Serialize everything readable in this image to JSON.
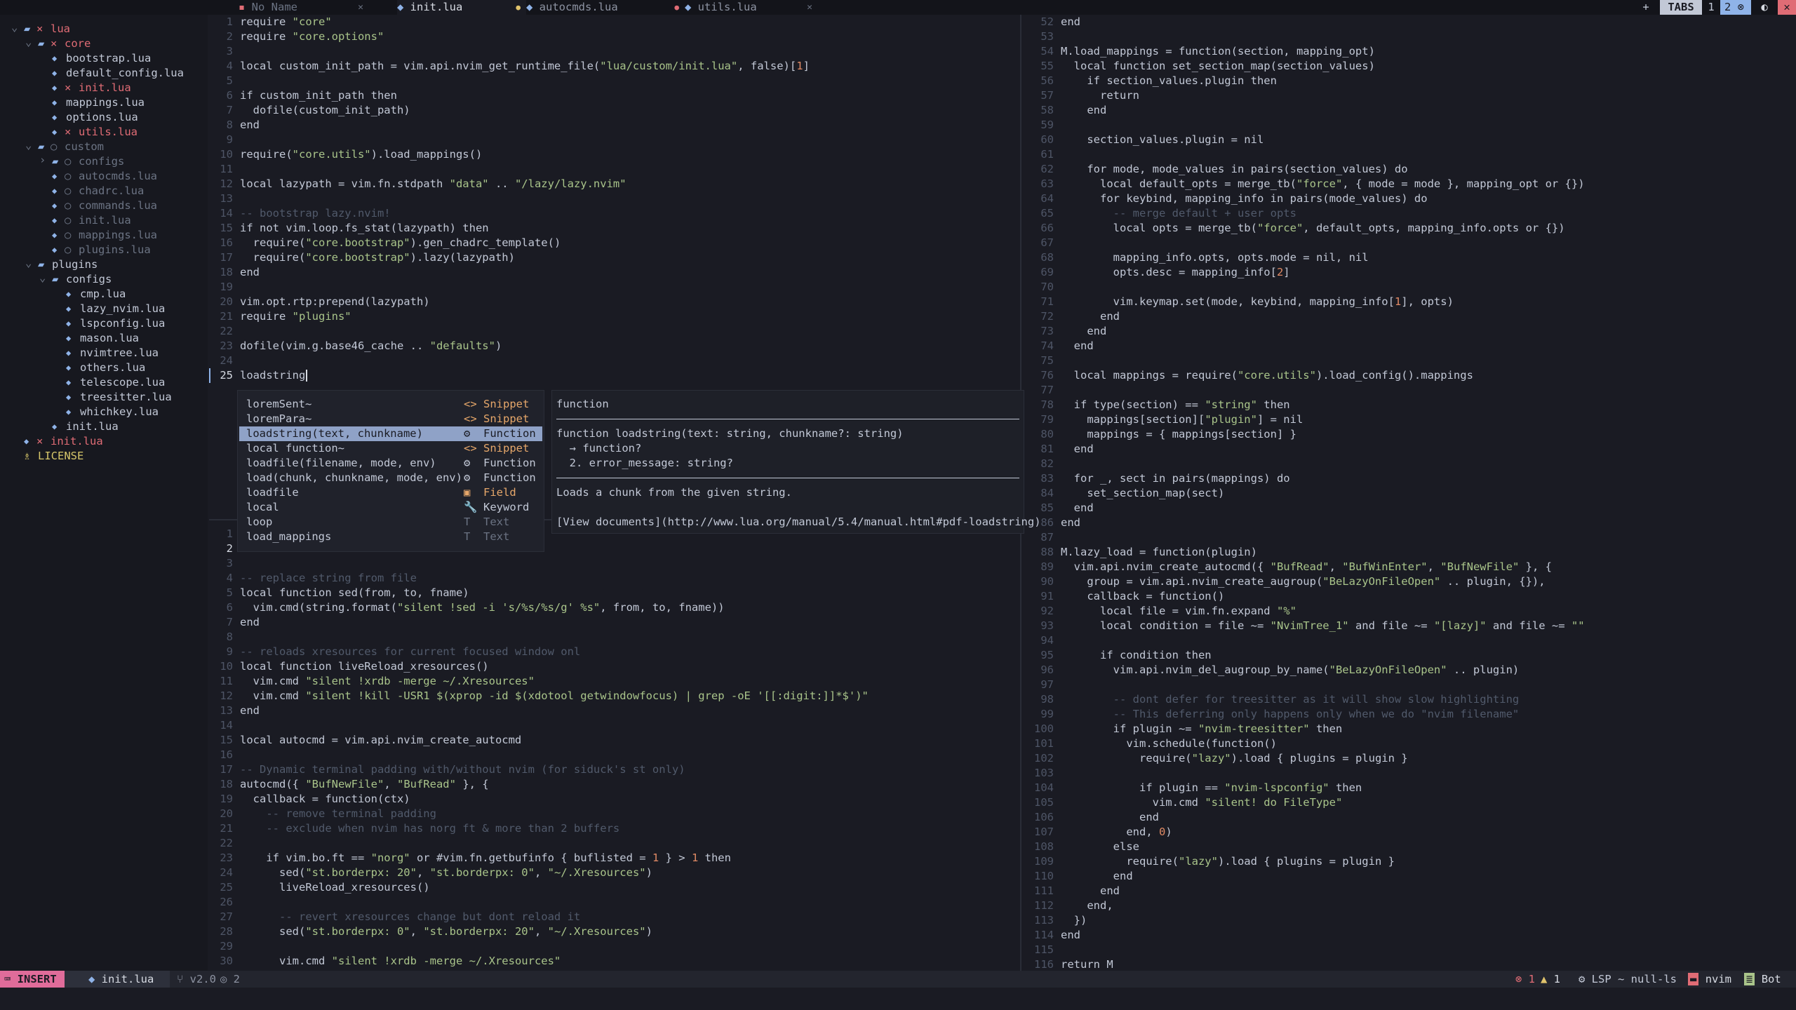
{
  "tabs": [
    {
      "label": "No Name",
      "icon": "file-icon",
      "mark": "close",
      "color": "#6b7383"
    },
    {
      "label": "init.lua",
      "icon": "lua-icon",
      "mark": "modified",
      "color": "#d7dbe3"
    },
    {
      "label": "autocmds.lua",
      "icon": "lua-icon",
      "mark": "error",
      "color": "#8d93a2"
    },
    {
      "label": "utils.lua",
      "icon": "lua-icon",
      "mark": "close",
      "color": "#8d93a2"
    }
  ],
  "tabbar_right": {
    "plus": "+",
    "tabs_label": "TABS",
    "tab1": "1",
    "tab2": "2"
  },
  "tree": [
    {
      "indent": 0,
      "arrow": "v",
      "icon": "folder-open-icon",
      "mark": "×",
      "label": "lua",
      "color": "#e06c75"
    },
    {
      "indent": 1,
      "arrow": "v",
      "icon": "folder-open-icon",
      "mark": "×",
      "label": "core",
      "color": "#e06c75"
    },
    {
      "indent": 2,
      "arrow": "",
      "icon": "lua-icon",
      "mark": "",
      "label": "bootstrap.lua",
      "color": "#c2c8d6"
    },
    {
      "indent": 2,
      "arrow": "",
      "icon": "lua-icon",
      "mark": "",
      "label": "default_config.lua",
      "color": "#c2c8d6"
    },
    {
      "indent": 2,
      "arrow": "",
      "icon": "lua-icon",
      "mark": "×",
      "label": "init.lua",
      "color": "#e06c75"
    },
    {
      "indent": 2,
      "arrow": "",
      "icon": "lua-icon",
      "mark": "",
      "label": "mappings.lua",
      "color": "#c2c8d6"
    },
    {
      "indent": 2,
      "arrow": "",
      "icon": "lua-icon",
      "mark": "",
      "label": "options.lua",
      "color": "#c2c8d6"
    },
    {
      "indent": 2,
      "arrow": "",
      "icon": "lua-icon",
      "mark": "×",
      "label": "utils.lua",
      "color": "#e06c75"
    },
    {
      "indent": 1,
      "arrow": "v",
      "icon": "folder-open-icon",
      "mark": "○",
      "label": "custom",
      "color": "#6b7383"
    },
    {
      "indent": 2,
      "arrow": ">",
      "icon": "folder-icon",
      "mark": "○",
      "label": "configs",
      "color": "#6b7383"
    },
    {
      "indent": 2,
      "arrow": "",
      "icon": "lua-icon",
      "mark": "○",
      "label": "autocmds.lua",
      "color": "#6b7383"
    },
    {
      "indent": 2,
      "arrow": "",
      "icon": "lua-icon",
      "mark": "○",
      "label": "chadrc.lua",
      "color": "#6b7383"
    },
    {
      "indent": 2,
      "arrow": "",
      "icon": "lua-icon",
      "mark": "○",
      "label": "commands.lua",
      "color": "#6b7383"
    },
    {
      "indent": 2,
      "arrow": "",
      "icon": "lua-icon",
      "mark": "○",
      "label": "init.lua",
      "color": "#6b7383"
    },
    {
      "indent": 2,
      "arrow": "",
      "icon": "lua-icon",
      "mark": "○",
      "label": "mappings.lua",
      "color": "#6b7383"
    },
    {
      "indent": 2,
      "arrow": "",
      "icon": "lua-icon",
      "mark": "○",
      "label": "plugins.lua",
      "color": "#6b7383"
    },
    {
      "indent": 1,
      "arrow": "v",
      "icon": "folder-open-icon",
      "mark": "",
      "label": "plugins",
      "color": "#c2c8d6"
    },
    {
      "indent": 2,
      "arrow": "v",
      "icon": "folder-open-icon",
      "mark": "",
      "label": "configs",
      "color": "#c2c8d6"
    },
    {
      "indent": 3,
      "arrow": "",
      "icon": "lua-icon",
      "mark": "",
      "label": "cmp.lua",
      "color": "#c2c8d6"
    },
    {
      "indent": 3,
      "arrow": "",
      "icon": "lua-icon",
      "mark": "",
      "label": "lazy_nvim.lua",
      "color": "#c2c8d6"
    },
    {
      "indent": 3,
      "arrow": "",
      "icon": "lua-icon",
      "mark": "",
      "label": "lspconfig.lua",
      "color": "#c2c8d6"
    },
    {
      "indent": 3,
      "arrow": "",
      "icon": "lua-icon",
      "mark": "",
      "label": "mason.lua",
      "color": "#c2c8d6"
    },
    {
      "indent": 3,
      "arrow": "",
      "icon": "lua-icon",
      "mark": "",
      "label": "nvimtree.lua",
      "color": "#c2c8d6"
    },
    {
      "indent": 3,
      "arrow": "",
      "icon": "lua-icon",
      "mark": "",
      "label": "others.lua",
      "color": "#c2c8d6"
    },
    {
      "indent": 3,
      "arrow": "",
      "icon": "lua-icon",
      "mark": "",
      "label": "telescope.lua",
      "color": "#c2c8d6"
    },
    {
      "indent": 3,
      "arrow": "",
      "icon": "lua-icon",
      "mark": "",
      "label": "treesitter.lua",
      "color": "#c2c8d6"
    },
    {
      "indent": 3,
      "arrow": "",
      "icon": "lua-icon",
      "mark": "",
      "label": "whichkey.lua",
      "color": "#c2c8d6"
    },
    {
      "indent": 2,
      "arrow": "",
      "icon": "lua-icon",
      "mark": "",
      "label": "init.lua",
      "color": "#c2c8d6"
    },
    {
      "indent": 0,
      "arrow": "",
      "icon": "lua-icon",
      "mark": "×",
      "label": "init.lua",
      "color": "#e06c75"
    },
    {
      "indent": 0,
      "arrow": "",
      "icon": "license-icon",
      "mark": "",
      "label": "LICENSE",
      "color": "#d7c76a"
    }
  ],
  "pane_top": [
    [
      "1",
      "require \"core\""
    ],
    [
      "2",
      "require \"core.options\""
    ],
    [
      "3",
      ""
    ],
    [
      "4",
      "local custom_init_path = vim.api.nvim_get_runtime_file(\"lua/custom/init.lua\", false)[1]"
    ],
    [
      "5",
      ""
    ],
    [
      "6",
      "if custom_init_path then"
    ],
    [
      "7",
      "  dofile(custom_init_path)"
    ],
    [
      "8",
      "end"
    ],
    [
      "9",
      ""
    ],
    [
      "10",
      "require(\"core.utils\").load_mappings()"
    ],
    [
      "11",
      ""
    ],
    [
      "12",
      "local lazypath = vim.fn.stdpath \"data\" .. \"/lazy/lazy.nvim\""
    ],
    [
      "13",
      ""
    ],
    [
      "14",
      "-- bootstrap lazy.nvim!"
    ],
    [
      "15",
      "if not vim.loop.fs_stat(lazypath) then"
    ],
    [
      "16",
      "  require(\"core.bootstrap\").gen_chadrc_template()"
    ],
    [
      "17",
      "  require(\"core.bootstrap\").lazy(lazypath)"
    ],
    [
      "18",
      "end"
    ],
    [
      "19",
      ""
    ],
    [
      "20",
      "vim.opt.rtp:prepend(lazypath)"
    ],
    [
      "21",
      "require \"plugins\""
    ],
    [
      "22",
      ""
    ],
    [
      "23",
      "dofile(vim.g.base46_cache .. \"defaults\")"
    ],
    [
      "24",
      ""
    ],
    [
      "25",
      "loadstring"
    ]
  ],
  "pane_bottom": [
    [
      "1",
      ""
    ],
    [
      "2",
      ""
    ],
    [
      "3",
      ""
    ],
    [
      "4",
      "-- replace string from file"
    ],
    [
      "5",
      "local function sed(from, to, fname)"
    ],
    [
      "6",
      "  vim.cmd(string.format(\"silent !sed -i 's/%s/%s/g' %s\", from, to, fname))"
    ],
    [
      "7",
      "end"
    ],
    [
      "8",
      ""
    ],
    [
      "9",
      "-- reloads xresources for current focused window onl"
    ],
    [
      "10",
      "local function liveReload_xresources()"
    ],
    [
      "11",
      "  vim.cmd \"silent !xrdb -merge ~/.Xresources\""
    ],
    [
      "12",
      "  vim.cmd \"silent !kill -USR1 $(xprop -id $(xdotool getwindowfocus) | grep -oE '[[:digit:]]*$')\""
    ],
    [
      "13",
      "end"
    ],
    [
      "14",
      ""
    ],
    [
      "15",
      "local autocmd = vim.api.nvim_create_autocmd"
    ],
    [
      "16",
      ""
    ],
    [
      "17",
      "-- Dynamic terminal padding with/without nvim (for siduck's st only)"
    ],
    [
      "18",
      "autocmd({ \"BufNewFile\", \"BufRead\" }, {"
    ],
    [
      "19",
      "  callback = function(ctx)"
    ],
    [
      "20",
      "    -- remove terminal padding"
    ],
    [
      "21",
      "    -- exclude when nvim has norg ft & more than 2 buffers"
    ],
    [
      "22",
      ""
    ],
    [
      "23",
      "    if vim.bo.ft == \"norg\" or #vim.fn.getbufinfo { buflisted = 1 } > 1 then"
    ],
    [
      "24",
      "      sed(\"st.borderpx: 20\", \"st.borderpx: 0\", \"~/.Xresources\")"
    ],
    [
      "25",
      "      liveReload_xresources()"
    ],
    [
      "26",
      ""
    ],
    [
      "27",
      "      -- revert xresources change but dont reload it"
    ],
    [
      "28",
      "      sed(\"st.borderpx: 0\", \"st.borderpx: 20\", \"~/.Xresources\")"
    ],
    [
      "29",
      ""
    ],
    [
      "30",
      "      vim.cmd \"silent !xrdb -merge ~/.Xresources\""
    ]
  ],
  "pane_right": [
    [
      "52",
      "end"
    ],
    [
      "53",
      ""
    ],
    [
      "54",
      "M.load_mappings = function(section, mapping_opt)"
    ],
    [
      "55",
      "  local function set_section_map(section_values)"
    ],
    [
      "56",
      "    if section_values.plugin then"
    ],
    [
      "57",
      "      return"
    ],
    [
      "58",
      "    end"
    ],
    [
      "59",
      ""
    ],
    [
      "60",
      "    section_values.plugin = nil"
    ],
    [
      "61",
      ""
    ],
    [
      "62",
      "    for mode, mode_values in pairs(section_values) do"
    ],
    [
      "63",
      "      local default_opts = merge_tb(\"force\", { mode = mode }, mapping_opt or {})"
    ],
    [
      "64",
      "      for keybind, mapping_info in pairs(mode_values) do"
    ],
    [
      "65",
      "        -- merge default + user opts"
    ],
    [
      "66",
      "        local opts = merge_tb(\"force\", default_opts, mapping_info.opts or {})"
    ],
    [
      "67",
      ""
    ],
    [
      "68",
      "        mapping_info.opts, opts.mode = nil, nil"
    ],
    [
      "69",
      "        opts.desc = mapping_info[2]"
    ],
    [
      "70",
      ""
    ],
    [
      "71",
      "        vim.keymap.set(mode, keybind, mapping_info[1], opts)"
    ],
    [
      "72",
      "      end"
    ],
    [
      "73",
      "    end"
    ],
    [
      "74",
      "  end"
    ],
    [
      "75",
      ""
    ],
    [
      "76",
      "  local mappings = require(\"core.utils\").load_config().mappings"
    ],
    [
      "77",
      ""
    ],
    [
      "78",
      "  if type(section) == \"string\" then"
    ],
    [
      "79",
      "    mappings[section][\"plugin\"] = nil"
    ],
    [
      "80",
      "    mappings = { mappings[section] }"
    ],
    [
      "81",
      "  end"
    ],
    [
      "82",
      ""
    ],
    [
      "83",
      "  for _, sect in pairs(mappings) do"
    ],
    [
      "84",
      "    set_section_map(sect)"
    ],
    [
      "85",
      "  end"
    ],
    [
      "86",
      "end"
    ],
    [
      "87",
      ""
    ],
    [
      "88",
      "M.lazy_load = function(plugin)"
    ],
    [
      "89",
      "  vim.api.nvim_create_autocmd({ \"BufRead\", \"BufWinEnter\", \"BufNewFile\" }, {"
    ],
    [
      "90",
      "    group = vim.api.nvim_create_augroup(\"BeLazyOnFileOpen\" .. plugin, {}),"
    ],
    [
      "91",
      "    callback = function()"
    ],
    [
      "92",
      "      local file = vim.fn.expand \"%\""
    ],
    [
      "93",
      "      local condition = file ~= \"NvimTree_1\" and file ~= \"[lazy]\" and file ~= \"\""
    ],
    [
      "94",
      ""
    ],
    [
      "95",
      "      if condition then"
    ],
    [
      "96",
      "        vim.api.nvim_del_augroup_by_name(\"BeLazyOnFileOpen\" .. plugin)"
    ],
    [
      "97",
      ""
    ],
    [
      "98",
      "        -- dont defer for treesitter as it will show slow highlighting"
    ],
    [
      "99",
      "        -- This deferring only happens only when we do \"nvim filename\""
    ],
    [
      "100",
      "        if plugin ~= \"nvim-treesitter\" then"
    ],
    [
      "101",
      "          vim.schedule(function()"
    ],
    [
      "102",
      "            require(\"lazy\").load { plugins = plugin }"
    ],
    [
      "103",
      ""
    ],
    [
      "104",
      "            if plugin == \"nvim-lspconfig\" then"
    ],
    [
      "105",
      "              vim.cmd \"silent! do FileType\""
    ],
    [
      "106",
      "            end"
    ],
    [
      "107",
      "          end, 0)"
    ],
    [
      "108",
      "        else"
    ],
    [
      "109",
      "          require(\"lazy\").load { plugins = plugin }"
    ],
    [
      "110",
      "        end"
    ],
    [
      "111",
      "      end"
    ],
    [
      "112",
      "    end,"
    ],
    [
      "113",
      "  })"
    ],
    [
      "114",
      "end"
    ],
    [
      "115",
      ""
    ],
    [
      "116",
      "return M"
    ]
  ],
  "completion": [
    {
      "label": "loremSent~",
      "kind_icon": "<>",
      "kind": "Snippet"
    },
    {
      "label": "loremPara~",
      "kind_icon": "<>",
      "kind": "Snippet"
    },
    {
      "label": "loadstring(text, chunkname)",
      "kind_icon": "⚙",
      "kind": "Function",
      "selected": true
    },
    {
      "label": "local function~",
      "kind_icon": "<>",
      "kind": "Snippet"
    },
    {
      "label": "loadfile(filename, mode, env)",
      "kind_icon": "⚙",
      "kind": "Function"
    },
    {
      "label": "load(chunk, chunkname, mode, env)",
      "kind_icon": "⚙",
      "kind": "Function"
    },
    {
      "label": "loadfile",
      "kind_icon": "▣",
      "kind": "Field"
    },
    {
      "label": "local",
      "kind_icon": "🔧",
      "kind": "Keyword"
    },
    {
      "label": "loop",
      "kind_icon": "T",
      "kind": "Text"
    },
    {
      "label": "load_mappings",
      "kind_icon": "T",
      "kind": "Text"
    }
  ],
  "doc": {
    "header": "function",
    "signature": "function loadstring(text: string, chunkname?: string)",
    "ret1": "  → function?",
    "ret2": "  2. error_message: string?",
    "desc": "Loads a chunk from the given string.",
    "link": "[View documents](http://www.lua.org/manual/5.4/manual.html#pdf-loadstring)"
  },
  "status": {
    "mode": "INSERT",
    "file": "init.lua",
    "branch": "v2.0",
    "changes": "2",
    "errors": "1",
    "warnings": "1",
    "lsp": "LSP ~ null-ls",
    "project": "nvim",
    "position": "Bot"
  }
}
